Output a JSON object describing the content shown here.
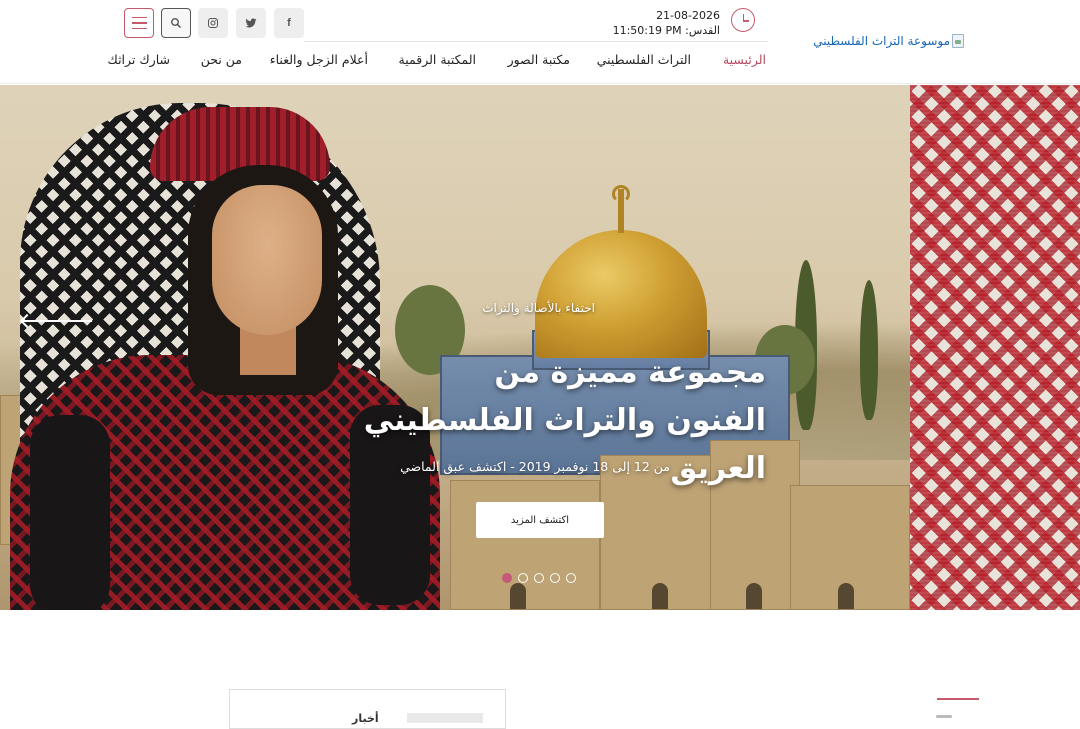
{
  "header": {
    "logo_alt": "موسوعة التراث الفلسطيني",
    "date": "21-08-2026",
    "time_label": "القدس:",
    "time": "11:50:19 PM",
    "social": [
      {
        "icon": "facebook-icon",
        "glyph": "f"
      },
      {
        "icon": "twitter-icon",
        "glyph": "🐦"
      },
      {
        "icon": "instagram-icon",
        "glyph": "◎"
      }
    ],
    "search_icon": "search-icon",
    "menu_icon": "hamburger-menu-icon",
    "accent_color": "#c45a6a"
  },
  "nav": {
    "items": [
      {
        "label": "الرئيسية",
        "active": true
      },
      {
        "label": "التراث الفلسطيني",
        "active": false
      },
      {
        "label": "مكتبة الصور",
        "active": false
      },
      {
        "label": "المكتبة الرقمية",
        "active": false
      },
      {
        "label": "أعلام الزجل والغناء",
        "active": false
      },
      {
        "label": "من نحن",
        "active": false
      },
      {
        "label": "شارك تراثك",
        "active": false
      }
    ]
  },
  "hero": {
    "eyebrow": "احتفاء بالأصالة والتراث",
    "title_line1": "مجموعة مميزة من",
    "title_line2": "الفنون والتراث الفلسطيني العريق",
    "subtitle": "من 12 إلى 18 نوفمبر 2019 - اكتشف عبق الماضي",
    "cta_label": "اكتشف المزيد",
    "slide_count": 5,
    "active_slide": 1
  },
  "below": {
    "card_label": "أخبار"
  }
}
